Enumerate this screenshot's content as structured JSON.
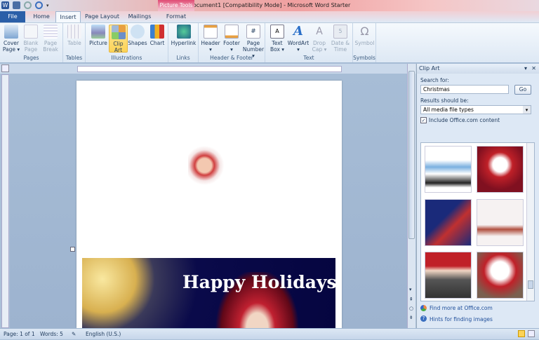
{
  "window": {
    "title": "Document1 [Compatibility Mode] - Microsoft Word Starter"
  },
  "tabs": [
    {
      "label": "File"
    },
    {
      "label": "Home"
    },
    {
      "label": "Insert"
    },
    {
      "label": "Page Layout"
    },
    {
      "label": "Mailings"
    },
    {
      "label": "Format"
    }
  ],
  "context_tab_group": "Picture Tools",
  "ribbon": {
    "groups": [
      {
        "label": "Pages",
        "buttons": [
          "Cover Page",
          "Blank Page",
          "Page Break"
        ]
      },
      {
        "label": "Tables",
        "buttons": [
          "Table"
        ]
      },
      {
        "label": "Illustrations",
        "buttons": [
          "Picture",
          "Clip Art",
          "Shapes",
          "Chart"
        ]
      },
      {
        "label": "Links",
        "buttons": [
          "Hyperlink"
        ]
      },
      {
        "label": "Header & Footer",
        "buttons": [
          "Header",
          "Footer",
          "Page Number"
        ]
      },
      {
        "label": "Text",
        "buttons": [
          "Text Box",
          "WordArt",
          "Drop Cap",
          "Date & Time"
        ]
      },
      {
        "label": "Symbols",
        "buttons": [
          "Symbol"
        ]
      }
    ]
  },
  "document": {
    "banner_text": "Happy Holidays"
  },
  "clipart_pane": {
    "title": "Clip Art",
    "search_label": "Search for:",
    "search_value": "Christmas",
    "go_label": "Go",
    "results_label": "Results should be:",
    "results_value": "All media file types",
    "include_label": "Include Office.com content",
    "include_checked": true,
    "find_more": "Find more at Office.com",
    "hints": "Hints for finding images"
  },
  "status": {
    "page": "Page: 1 of 1",
    "words": "Words: 5",
    "language": "English (U.S.)"
  },
  "colors": {
    "file_tab": "#2a5fa8",
    "context": "#e04b74",
    "selected": "#fcd357"
  }
}
